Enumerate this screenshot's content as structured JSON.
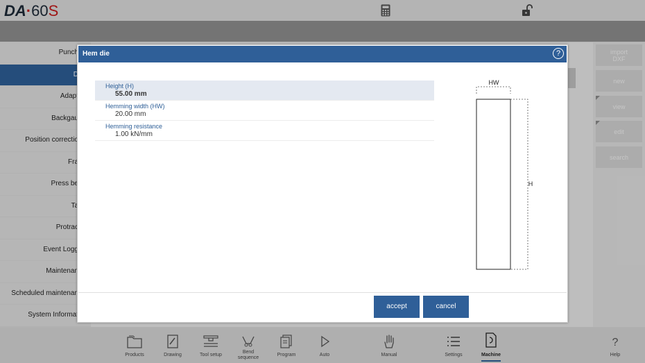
{
  "app": {
    "logo_da": "DA",
    "logo_dot": "·",
    "logo_model": "60",
    "logo_s": "S"
  },
  "sidebar": {
    "items": [
      {
        "label": "Punch"
      },
      {
        "label": "D",
        "active": true
      },
      {
        "label": "Adapt"
      },
      {
        "label": "Backgau"
      },
      {
        "label": "Position correctio"
      },
      {
        "label": "Fra"
      },
      {
        "label": "Press be"
      },
      {
        "label": "Ta"
      },
      {
        "label": "Protrac"
      },
      {
        "label": "Event Logg"
      },
      {
        "label": "Maintenan"
      },
      {
        "label": "Scheduled maintenan"
      },
      {
        "label": "System Informat"
      }
    ]
  },
  "right_panel": {
    "import_label": "import DXF",
    "new_label": "new",
    "view_label": "view",
    "edit_label": "edit",
    "search_label": "search"
  },
  "dialog": {
    "title": "Hem die",
    "params": [
      {
        "label": "Height (H)",
        "value": "55.00 mm"
      },
      {
        "label": "Hemming width (HW)",
        "value": "20.00 mm"
      },
      {
        "label": "Hemming resistance",
        "value": "1.00 kN/mm"
      }
    ],
    "diagram": {
      "hw_label": "HW",
      "h_label": "H"
    },
    "accept_label": "accept",
    "cancel_label": "cancel"
  },
  "bottom_nav": {
    "items": [
      {
        "label": "Products",
        "icon": "folder-icon"
      },
      {
        "label": "Drawing",
        "icon": "drawing-icon"
      },
      {
        "label": "Tool setup",
        "icon": "tool-setup-icon"
      },
      {
        "label": "Bend sequence",
        "icon": "bend-sequence-icon"
      },
      {
        "label": "Program",
        "icon": "program-icon"
      },
      {
        "label": "Auto",
        "icon": "play-icon"
      },
      {
        "label": "Manual",
        "icon": "hand-icon"
      },
      {
        "label": "Settings",
        "icon": "list-icon"
      },
      {
        "label": "Machine",
        "icon": "machine-icon",
        "active": true
      },
      {
        "label": "Help",
        "icon": "help-icon"
      }
    ]
  },
  "colors": {
    "accent": "#2f5f98",
    "logo_red": "#c21c1c",
    "selected_row": "#e4e9f1"
  }
}
